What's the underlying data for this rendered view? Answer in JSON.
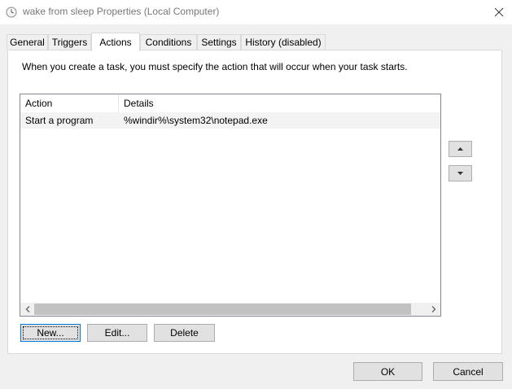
{
  "window": {
    "title": "wake from sleep Properties (Local Computer)",
    "icon": "clock-icon"
  },
  "tabs": [
    {
      "label": "General",
      "active": false
    },
    {
      "label": "Triggers",
      "active": false
    },
    {
      "label": "Actions",
      "active": true
    },
    {
      "label": "Conditions",
      "active": false
    },
    {
      "label": "Settings",
      "active": false
    },
    {
      "label": "History (disabled)",
      "active": false
    }
  ],
  "actions_tab": {
    "instruction": "When you create a task, you must specify the action that will occur when your task starts.",
    "columns": [
      "Action",
      "Details"
    ],
    "rows": [
      {
        "action": "Start a program",
        "details": "%windir%\\system32\\notepad.exe"
      }
    ],
    "buttons": {
      "new": "New...",
      "edit": "Edit...",
      "delete": "Delete"
    }
  },
  "footer": {
    "ok": "OK",
    "cancel": "Cancel"
  },
  "colors": {
    "accent": "#0078d7",
    "window_bg": "#f0f0f0",
    "row_highlight": "#f3f3f3"
  }
}
